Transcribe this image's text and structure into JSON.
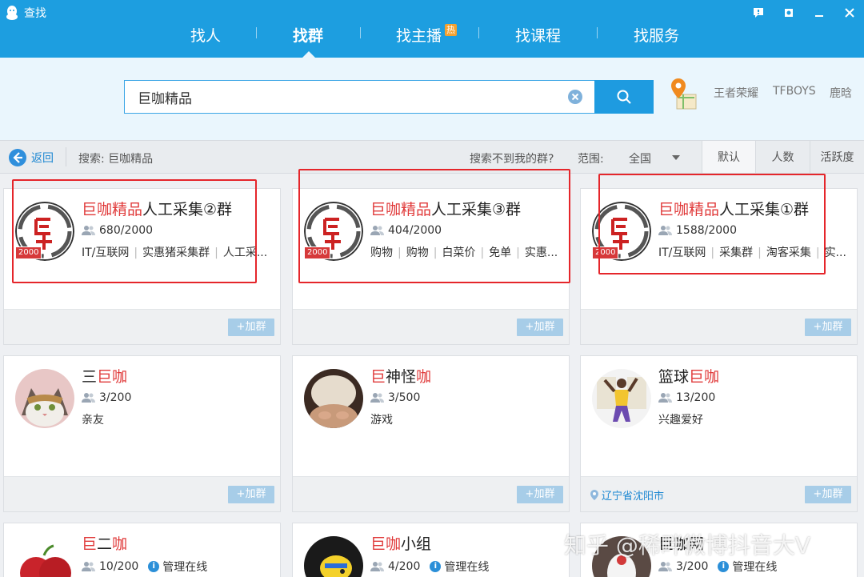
{
  "app": {
    "title": "查找"
  },
  "nav": {
    "tabs": [
      {
        "label": "找人"
      },
      {
        "label": "找群"
      },
      {
        "label": "找主播",
        "badge": "热"
      },
      {
        "label": "找课程"
      },
      {
        "label": "找服务"
      }
    ],
    "active": "找群"
  },
  "search": {
    "value": "巨咖精品",
    "placeholder": ""
  },
  "hot_keywords": [
    "王者荣耀",
    "TFBOYS",
    "鹿晗"
  ],
  "filterbar": {
    "back_label": "返回",
    "query_label": "搜索: 巨咖精品",
    "cant_find": "搜索不到我的群?",
    "range_label": "范围:",
    "range_value": "全国",
    "sort_tabs": [
      "默认",
      "人数",
      "活跃度"
    ]
  },
  "join_label": "+加群",
  "cards": [
    {
      "title_hl": "巨咖精品",
      "title_rest": "人工采集②群",
      "members": "680/2000",
      "tags": [
        "IT/互联网",
        "实惠猪采集群",
        "人工采..."
      ],
      "badge": "2000"
    },
    {
      "title_hl": "巨咖精品",
      "title_rest": "人工采集③群",
      "members": "404/2000",
      "tags": [
        "购物",
        "购物",
        "白菜价",
        "免单",
        "实惠..."
      ],
      "badge": "2000"
    },
    {
      "title_hl": "巨咖精品",
      "title_rest": "人工采集①群",
      "members": "1588/2000",
      "tags": [
        "IT/互联网",
        "采集群",
        "淘客采集",
        "实..."
      ],
      "badge": "2000"
    },
    {
      "title_pre": "三",
      "title_hl": "巨咖",
      "title_rest": "",
      "members": "3/200",
      "tags": [
        "亲友"
      ]
    },
    {
      "title_hl": "巨",
      "title_mid": "神怪",
      "title_hl2": "咖",
      "title_rest": "",
      "members": "3/500",
      "tags": [
        "游戏"
      ]
    },
    {
      "title_pre": "篮球",
      "title_hl": "巨咖",
      "title_rest": "",
      "members": "13/200",
      "tags": [
        "兴趣爱好"
      ],
      "location": "辽宁省沈阳市"
    },
    {
      "title_hl": "巨",
      "title_mid": "二",
      "title_hl2": "咖",
      "title_rest": "",
      "members": "10/200",
      "status": "管理在线"
    },
    {
      "title_hl": "巨咖",
      "title_rest": "小组",
      "members": "4/200",
      "status": "管理在线"
    },
    {
      "title_rest": "巨咖网",
      "members": "3/200",
      "status": "管理在线"
    }
  ],
  "watermark": "知乎 @稀畔微博抖音大V",
  "colors": {
    "accent": "#1d9ee0",
    "highlight": "#e03a3a",
    "annotation_box": "#e5262b"
  }
}
